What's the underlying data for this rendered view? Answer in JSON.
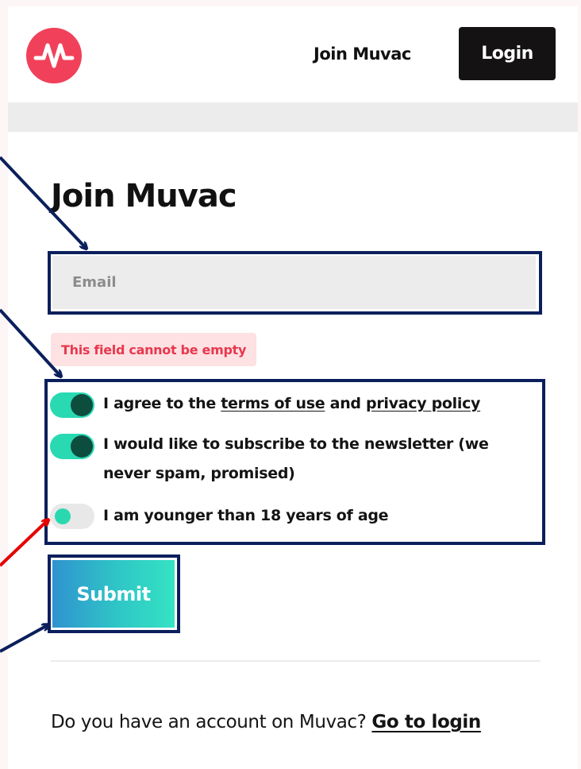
{
  "header": {
    "nav_join": "Join Muvac",
    "login_label": "Login"
  },
  "form": {
    "title": "Join Muvac",
    "email_placeholder": "Email",
    "error_message": "This field cannot be empty",
    "terms": {
      "prefix": "I agree to the ",
      "terms_link": "terms of use",
      "middle": " and ",
      "privacy_link": "privacy policy",
      "checked": true
    },
    "newsletter": {
      "line1": "I would like to subscribe to the newsletter (we",
      "line2": "never spam, promised)",
      "checked": true
    },
    "age": {
      "label": "I am younger than 18 years of age",
      "checked": false
    },
    "submit_label": "Submit"
  },
  "footer": {
    "question": "Do you have an account on Muvac? ",
    "login_link": "Go to login"
  },
  "colors": {
    "brand": "#f1415a",
    "toggle_on": "#29d9b2",
    "error": "#e8384e",
    "annotation": "#0b1f5c",
    "annotation_alert": "#e60000"
  }
}
